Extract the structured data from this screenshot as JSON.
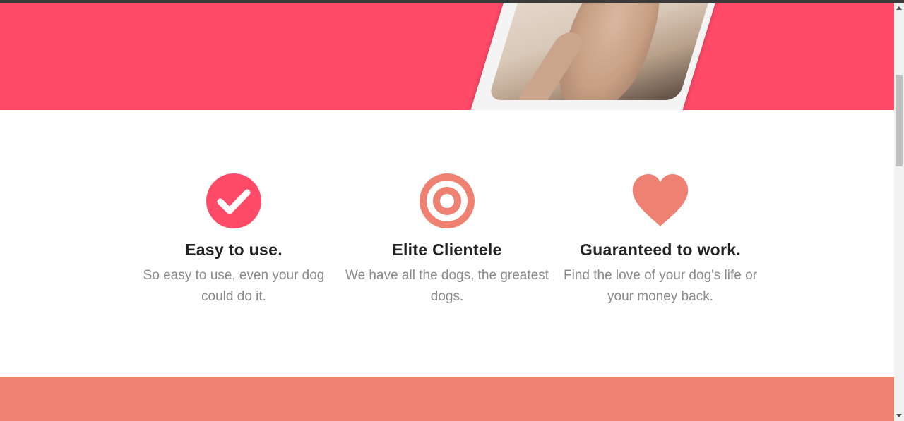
{
  "hero": {
    "background_color": "#ff4a68",
    "image": "phone-with-dog-photo"
  },
  "features": [
    {
      "icon": "check-circle-icon",
      "icon_color": "#ff4a68",
      "title": "Easy to use.",
      "description": "So easy to use, even your dog could do it."
    },
    {
      "icon": "target-icon",
      "icon_color": "#ef8172",
      "title": "Elite Clientele",
      "description": "We have all the dogs, the greatest dogs."
    },
    {
      "icon": "heart-icon",
      "icon_color": "#ef8172",
      "title": "Guaranteed to work.",
      "description": "Find the love of your dog's life or your money back."
    }
  ],
  "bottom_band": {
    "background_color": "#ef8172"
  }
}
